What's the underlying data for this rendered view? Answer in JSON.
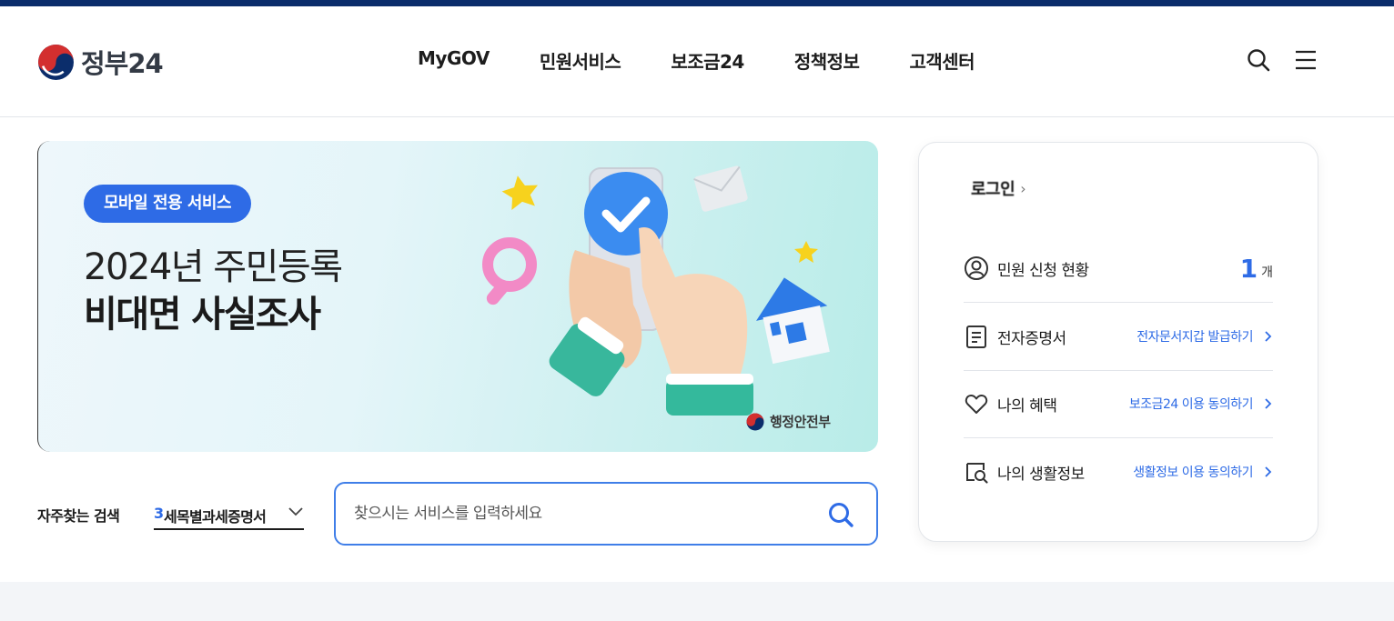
{
  "header": {
    "logo_text": "정부24",
    "nav": [
      "MyGOV",
      "민원서비스",
      "보조금24",
      "정책정보",
      "고객센터"
    ],
    "search_icon": "search-icon",
    "menu_icon": "hamburger-menu-icon"
  },
  "banner": {
    "badge": "모바일 전용 서비스",
    "line1": "2024년 주민등록",
    "line2": "비대면 사실조사",
    "ministry": "행정안전부"
  },
  "favorite_search": {
    "label": "자주찾는 검색",
    "rank": "3",
    "term": "세목별과세증명서"
  },
  "search": {
    "placeholder": "찾으시는 서비스를 입력하세요"
  },
  "side_card": {
    "login_text": "로그인",
    "rows": [
      {
        "icon": "user-circle-icon",
        "label": "민원 신청 현황",
        "count": "1",
        "unit": "개"
      },
      {
        "icon": "document-icon",
        "label": "전자증명서",
        "link": "전자문서지갑 발급하기"
      },
      {
        "icon": "heart-icon",
        "label": "나의 혜택",
        "link": "보조금24 이용 동의하기"
      },
      {
        "icon": "life-info-search-icon",
        "label": "나의 생활정보",
        "link": "생활정보 이용 동의하기"
      }
    ]
  },
  "colors": {
    "brand_navy": "#0b2d6b",
    "accent_blue": "#2e6be6"
  }
}
